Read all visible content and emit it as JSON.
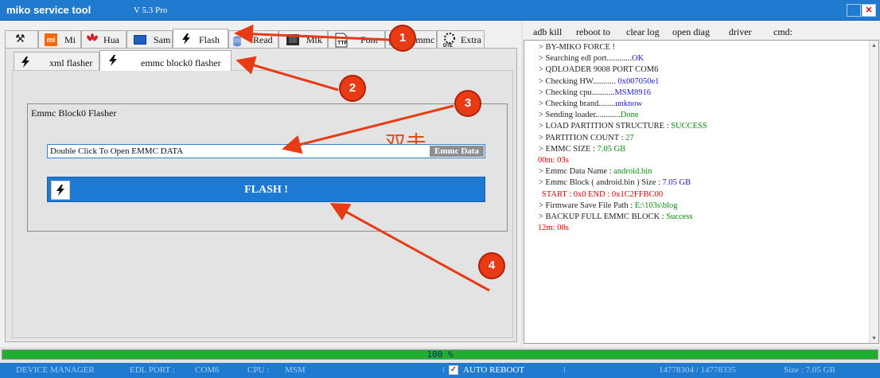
{
  "window": {
    "title": "miko service tool",
    "version": "V 5.3 Pro",
    "close_icon": "✕"
  },
  "tabs": [
    {
      "name": "tools",
      "label": "",
      "icon": "wrench-screwdriver-icon"
    },
    {
      "name": "mi",
      "label": "Mi",
      "icon": "mi-icon"
    },
    {
      "name": "hua",
      "label": "Hua",
      "icon": "huawei-icon"
    },
    {
      "name": "sam",
      "label": "Sam",
      "icon": "samsung-icon"
    },
    {
      "name": "flash",
      "label": "Flash",
      "icon": "bolt-icon"
    },
    {
      "name": "read",
      "label": "Read",
      "icon": "disk-icon"
    },
    {
      "name": "mtk",
      "label": "Mtk",
      "icon": "chip-icon"
    },
    {
      "name": "font",
      "label": "Font",
      "icon": "font-file-icon"
    },
    {
      "name": "emmc",
      "label": "emmc",
      "icon": "emmc-icon"
    },
    {
      "name": "extra",
      "label": "Extra",
      "icon": "dte-icon"
    }
  ],
  "subtabs": [
    {
      "label": "xml flasher",
      "icon": "bolt-icon"
    },
    {
      "label": "emmc block0 flasher",
      "icon": "bolt-icon"
    }
  ],
  "flasher": {
    "group_title": "Emmc Block0 Flasher",
    "input_value": "Double Click To Open EMMC DATA",
    "emmc_data_button": "Emmc Data",
    "flash_button": "FLASH !",
    "note_text": "双击"
  },
  "cmdbar": [
    "adb kill",
    "reboot to",
    "clear log",
    "open diag",
    "driver",
    "cmd:"
  ],
  "log": [
    {
      "prefix": "> BY-MIKO FORCE !",
      "value": "",
      "color": "black"
    },
    {
      "prefix": "> Searching edl port............",
      "value": "OK",
      "color": "blue"
    },
    {
      "prefix": "> QDLOADER 9008 PORT COM6",
      "value": "",
      "color": "black"
    },
    {
      "prefix": "> Checking HW........... ",
      "value": "0x007050e1",
      "color": "blue"
    },
    {
      "prefix": "> Checking cpu...........",
      "value": "MSM8916",
      "color": "blue"
    },
    {
      "prefix": "> Checking brand........",
      "value": "unknow",
      "color": "blue"
    },
    {
      "prefix": "> Sending loader............",
      "value": "Done",
      "color": "green"
    },
    {
      "prefix": "> LOAD PARTITION  STRUCTURE  :  ",
      "value": "SUCCESS",
      "color": "green"
    },
    {
      "prefix": "> PARTITION COUNT  :  ",
      "value": "27",
      "color": "green"
    },
    {
      "prefix": "> EMMC SIZE   :  ",
      "value": "7.05 GB",
      "color": "green"
    },
    {
      "prefix": "",
      "value": "00m: 03s",
      "color": "red"
    },
    {
      "prefix": "> Emmc Data Name  :  ",
      "value": "android.bin",
      "color": "green"
    },
    {
      "prefix": "> Emmc Block ( android.bin ) Size   :  ",
      "value": "7.05 GB",
      "color": "blue"
    },
    {
      "prefix": "",
      "value": "START  :  0x0    END  :  0x1C2FFBC00",
      "color": "red"
    },
    {
      "prefix": "> Firmware Save File  Path : ",
      "value": "E:\\103s\\blog",
      "color": "green"
    },
    {
      "prefix": "> BACKUP FULL EMMC BLOCK  :  ",
      "value": "Success",
      "color": "green"
    },
    {
      "prefix": "",
      "value": "12m: 08s",
      "color": "red"
    }
  ],
  "colors": {
    "blue": "#1b1bc4",
    "green": "#0a8a0a",
    "red": "#e00000",
    "black": "#222222",
    "accent": "#1f7ad0"
  },
  "progress": {
    "value": 1.0,
    "label": "100 %"
  },
  "status": {
    "device_manager": "DEVICE MANAGER",
    "edl_port_label": "EDL PORT  :",
    "edl_port_value": "COM6",
    "cpu_label": "CPU  :",
    "cpu_value": "MSM",
    "auto_reboot": "AUTO REBOOT",
    "auto_reboot_checked": true,
    "check_glyph": "✓",
    "sep": "⁞",
    "counts": "14778304   /   14778335",
    "size": "Size  :  7.05 GB"
  },
  "annotations": [
    "1",
    "2",
    "3",
    "4"
  ]
}
